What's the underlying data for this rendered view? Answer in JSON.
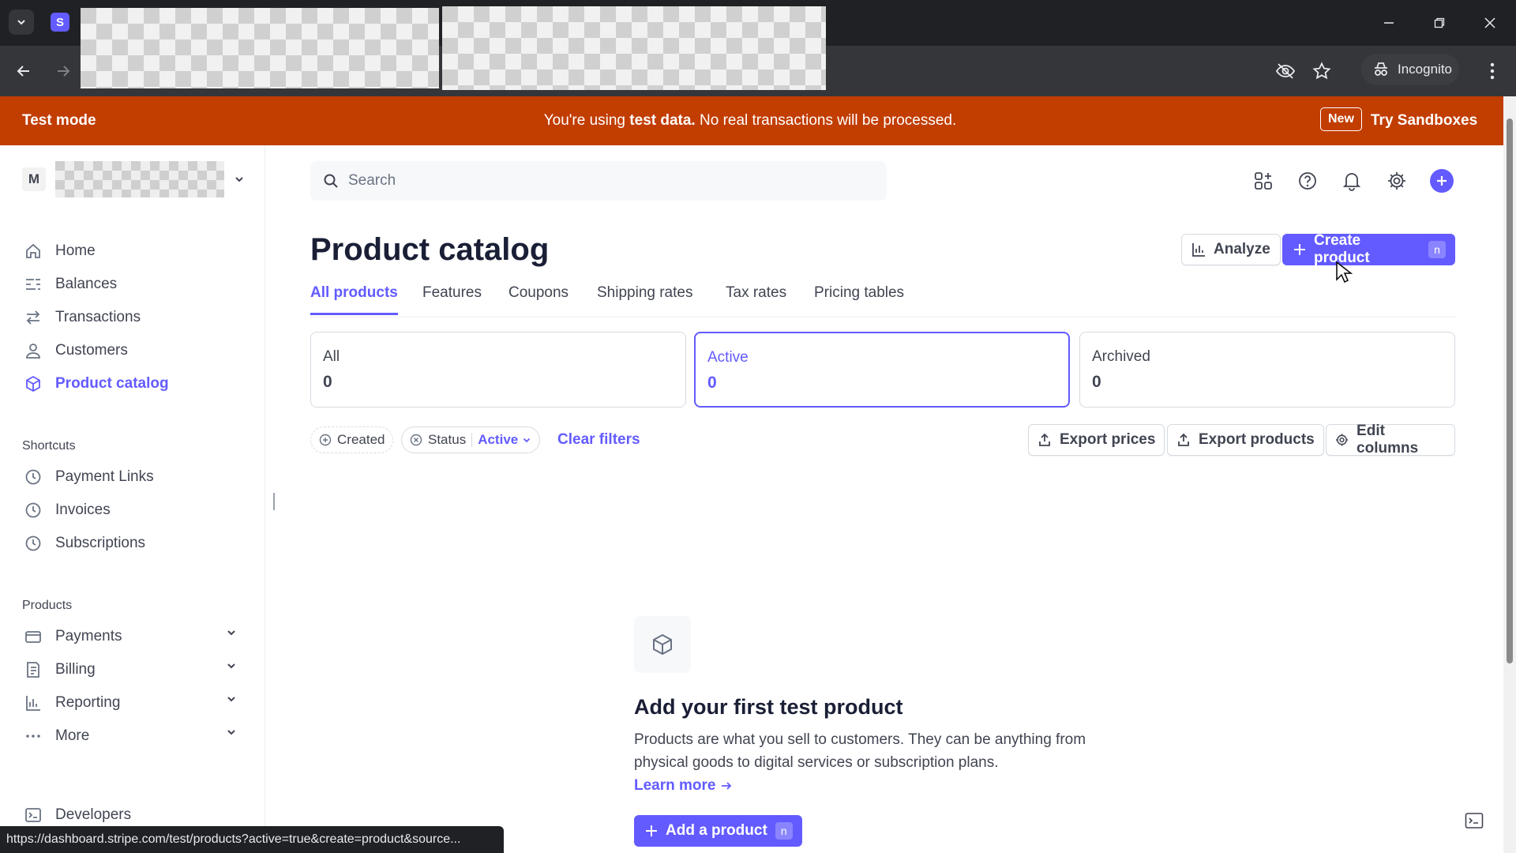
{
  "browser": {
    "tab_favicon_letter": "S",
    "incognito_label": "Incognito",
    "status_url": "https://dashboard.stripe.com/test/products?active=true&create=product&source..."
  },
  "banner": {
    "title": "Test mode",
    "message_prefix": "You're using ",
    "message_bold": "test data.",
    "message_suffix": " No real transactions will be processed.",
    "new_badge": "New",
    "try_link": "Try Sandboxes",
    "color": "#c23d00"
  },
  "account": {
    "initial": "M"
  },
  "sidebar": {
    "main_items": [
      {
        "label": "Home",
        "icon": "home-icon"
      },
      {
        "label": "Balances",
        "icon": "balances-icon"
      },
      {
        "label": "Transactions",
        "icon": "transactions-icon"
      },
      {
        "label": "Customers",
        "icon": "customers-icon"
      },
      {
        "label": "Product catalog",
        "icon": "product-catalog-icon",
        "active": true
      }
    ],
    "shortcuts_label": "Shortcuts",
    "shortcuts": [
      {
        "label": "Payment Links",
        "icon": "clock-icon"
      },
      {
        "label": "Invoices",
        "icon": "clock-icon"
      },
      {
        "label": "Subscriptions",
        "icon": "clock-icon"
      }
    ],
    "products_label": "Products",
    "products": [
      {
        "label": "Payments",
        "icon": "payments-icon"
      },
      {
        "label": "Billing",
        "icon": "billing-icon"
      },
      {
        "label": "Reporting",
        "icon": "reporting-icon"
      },
      {
        "label": "More",
        "icon": "more-icon"
      }
    ],
    "developers": "Developers"
  },
  "header": {
    "search_placeholder": "Search"
  },
  "page": {
    "title": "Product catalog",
    "analyze_label": "Analyze",
    "create_label": "Create product",
    "create_shortcut": "n",
    "tabs": [
      "All products",
      "Features",
      "Coupons",
      "Shipping rates",
      "Tax rates",
      "Pricing tables"
    ],
    "status_cards": [
      {
        "label": "All",
        "count": "0"
      },
      {
        "label": "Active",
        "count": "0"
      },
      {
        "label": "Archived",
        "count": "0"
      }
    ],
    "filters": {
      "created": "Created",
      "status": "Status",
      "status_value": "Active",
      "clear": "Clear filters"
    },
    "actions": {
      "export_prices": "Export prices",
      "export_products": "Export products",
      "edit_columns": "Edit columns"
    },
    "empty": {
      "title": "Add your first test product",
      "description": "Products are what you sell to customers. They can be anything from physical goods to digital services or subscription plans.",
      "learn_more": "Learn more",
      "add_label": "Add a product",
      "add_shortcut": "n"
    }
  },
  "colors": {
    "accent": "#635bff",
    "text": "#414552"
  }
}
